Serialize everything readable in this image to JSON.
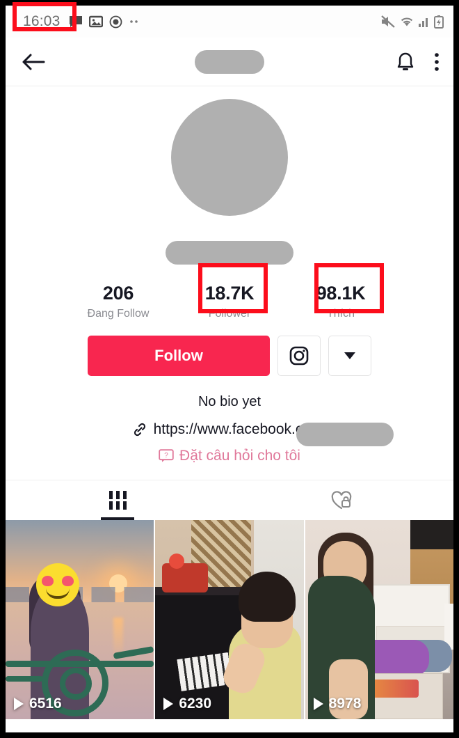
{
  "status_bar": {
    "time": "16:03",
    "left_icons": [
      "message-icon",
      "image-icon",
      "circle-app-icon",
      "more-dots-icon"
    ],
    "right_icons": [
      "mute-icon",
      "wifi-icon",
      "signal-icon",
      "battery-icon"
    ]
  },
  "app_bar": {
    "back_icon": "back-arrow-icon",
    "title_redacted": true,
    "notification_icon": "bell-icon",
    "more_icon": "three-dot-menu-icon"
  },
  "profile": {
    "avatar_redacted": true,
    "username_redacted": true,
    "stats": [
      {
        "value": "206",
        "label": "Đang Follow",
        "highlighted": false
      },
      {
        "value": "18.7K",
        "label": "Follower",
        "highlighted": true
      },
      {
        "value": "98.1K",
        "label": "Thích",
        "highlighted": true
      }
    ],
    "follow_label": "Follow",
    "instagram_icon": "instagram-icon",
    "dropdown_icon": "chevron-down-icon",
    "bio": "No bio yet",
    "link_icon": "link-icon",
    "link_text": "https://www.facebook.com/",
    "link_handle_redacted": true,
    "ask_icon": "question-bubble-icon",
    "ask_label": "Đặt câu hỏi cho tôi"
  },
  "tabs": [
    {
      "icon": "videos-grid-icon",
      "active": true
    },
    {
      "icon": "heart-lock-icon",
      "active": false
    }
  ],
  "videos": [
    {
      "views": "6516",
      "play_icon": "play-icon",
      "description": "sunset-lake-woman"
    },
    {
      "views": "6230",
      "play_icon": "play-icon",
      "description": "woman-playing-piano"
    },
    {
      "views": "8978",
      "play_icon": "play-icon",
      "description": "woman-green-dress-bedroom"
    }
  ],
  "colors": {
    "accent": "#f8264f",
    "annotation": "#fc0d1b",
    "ask_text": "#e0789a",
    "redaction": "#b0b0b0"
  }
}
